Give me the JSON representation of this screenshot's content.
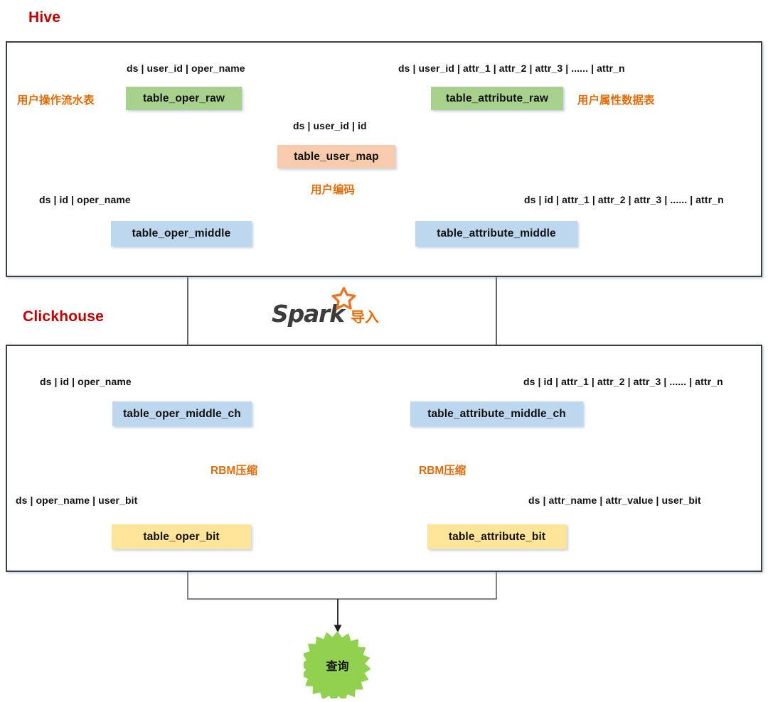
{
  "diagram": {
    "title": "Hive to Clickhouse RBM pipeline",
    "colors": {
      "section_title": "#C00000",
      "note": "#E36C09",
      "raw_table": "#A9D18E",
      "middle_table": "#BDD7EE",
      "map_table": "#F8CBAD",
      "bit_table": "#FFE599",
      "query_burst": "#92D050",
      "frame_border": "#3A3F47"
    }
  },
  "sections": {
    "hive": {
      "label": "Hive"
    },
    "clickhouse": {
      "label": "Clickhouse"
    }
  },
  "nodes": {
    "oper_raw": {
      "label": "table_oper_raw"
    },
    "attribute_raw": {
      "label": "table_attribute_raw"
    },
    "user_map": {
      "label": "table_user_map"
    },
    "oper_middle": {
      "label": "table_oper_middle"
    },
    "attribute_middle": {
      "label": "table_attribute_middle"
    },
    "oper_middle_ch": {
      "label": "table_oper_middle_ch"
    },
    "attribute_middle_ch": {
      "label": "table_attribute_middle_ch"
    },
    "oper_bit": {
      "label": "table_oper_bit"
    },
    "attribute_bit": {
      "label": "table_attribute_bit"
    },
    "query": {
      "label": "查询"
    }
  },
  "schemas": {
    "oper_raw": "ds | user_id | oper_name",
    "attribute_raw": "ds | user_id | attr_1 | attr_2 | attr_3 | ...... | attr_n",
    "user_map": "ds | user_id | id",
    "oper_middle": "ds | id | oper_name",
    "attribute_middle": "ds | id | attr_1 | attr_2 | attr_3 | ...... | attr_n",
    "oper_middle_ch": "ds | id | oper_name",
    "attribute_middle_ch": "ds | id | attr_1 | attr_2 | attr_3 | ...... | attr_n",
    "oper_bit": "ds | oper_name | user_bit",
    "attribute_bit": "ds | attr_name | attr_value | user_bit"
  },
  "notes": {
    "oper_raw_desc": "用户操作流水表",
    "attribute_raw_desc": "用户属性数据表",
    "user_map_desc": "用户编码",
    "rbm_left": "RBM压缩",
    "rbm_right": "RBM压缩"
  },
  "spark": {
    "wordmark": "Spark",
    "action": "导入",
    "star_icon": "star-icon"
  }
}
